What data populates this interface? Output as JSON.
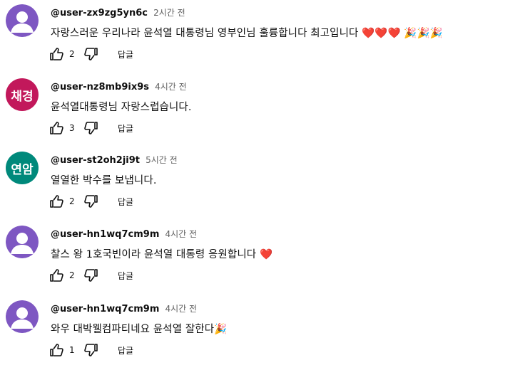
{
  "comments": [
    {
      "username": "@user-zx9zg5yn6c",
      "time": "2시간 전",
      "text": "자랑스러운  우리나라   윤석열 대통령님  영부인님   훌륭합니다 최고입니다   ❤️❤️❤️ 🎉🎉🎉",
      "likes": "2",
      "reply": "답글",
      "avatar": {
        "type": "default",
        "text": "",
        "color": "#7e57c2"
      }
    },
    {
      "username": "@user-nz8mb9ix9s",
      "time": "4시간 전",
      "text": "윤석열대통령님 자랑스럽습니다.",
      "likes": "3",
      "reply": "답글",
      "avatar": {
        "type": "text",
        "text": "채경",
        "color": "#c2185b"
      }
    },
    {
      "username": "@user-st2oh2ji9t",
      "time": "5시간 전",
      "text": "열열한  박수를 보냅니다.",
      "likes": "2",
      "reply": "답글",
      "avatar": {
        "type": "text",
        "text": "연암",
        "color": "#00897b"
      }
    },
    {
      "username": "@user-hn1wq7cm9m",
      "time": "4시간 전",
      "text": "찰스 왕 1호국빈이라 윤석열 대통령 응원합니다 ❤️",
      "likes": "2",
      "reply": "답글",
      "avatar": {
        "type": "default",
        "text": "",
        "color": "#7e57c2"
      }
    },
    {
      "username": "@user-hn1wq7cm9m",
      "time": "4시간 전",
      "text": "와우 대박웰컴파티네요 윤석열 잘한다🎉",
      "likes": "1",
      "reply": "답글",
      "avatar": {
        "type": "default",
        "text": "",
        "color": "#7e57c2"
      }
    }
  ],
  "icons": {
    "like": "thumbs-up-icon",
    "dislike": "thumbs-down-icon"
  }
}
